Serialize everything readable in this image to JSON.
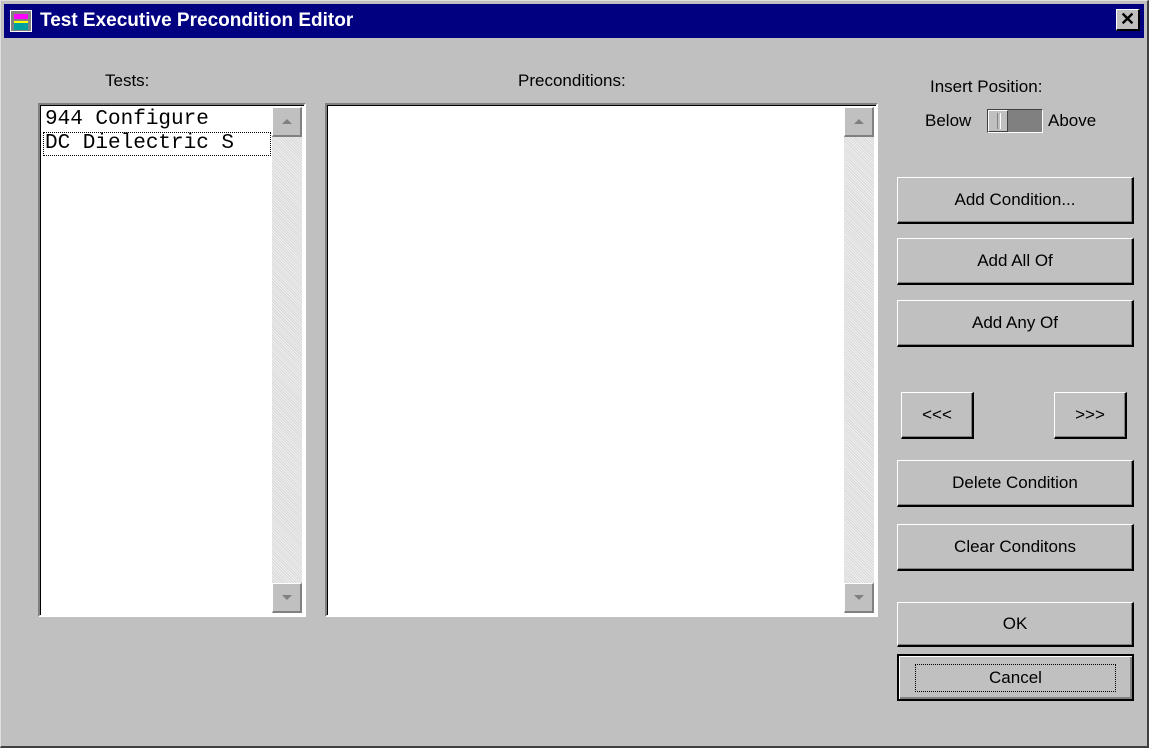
{
  "window": {
    "title": "Test Executive Precondition Editor",
    "close_label": "✕"
  },
  "tests": {
    "label": "Tests:",
    "items": [
      "944 Configure",
      "DC Dielectric S"
    ],
    "focused_index": 1
  },
  "preconditions": {
    "label": "Preconditions:",
    "items": []
  },
  "insert_position": {
    "label": "Insert Position:",
    "below_label": "Below",
    "above_label": "Above",
    "value": "Below"
  },
  "buttons": {
    "add_condition": "Add Condition...",
    "add_all_of": "Add All Of",
    "add_any_of": "Add Any Of",
    "move_left": "<<<",
    "move_right": ">>>",
    "delete_condition": "Delete Condition",
    "clear_conditions": "Clear Conditons",
    "ok": "OK",
    "cancel": "Cancel"
  },
  "colors": {
    "titlebar": "#000080",
    "face": "#c0c0c0",
    "list_background": "#ffffff"
  }
}
